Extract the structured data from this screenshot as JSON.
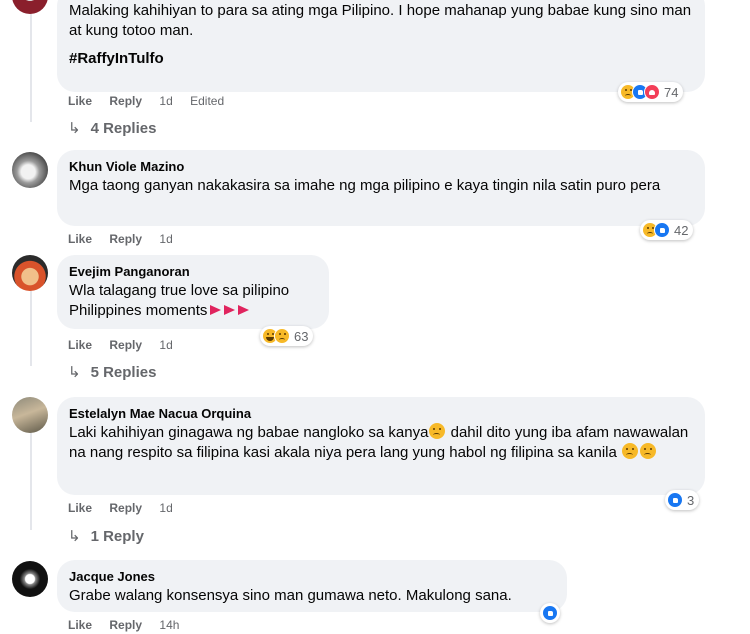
{
  "colors": {
    "bubble": "#f0f2f5",
    "meta": "#65676b",
    "like": "#1877f2",
    "love": "#f33e58",
    "emoji": "#f7b928"
  },
  "comments": [
    {
      "author": "",
      "text": "Malaking kahihiyan to para sa ating mga Pilipino. I hope mahanap yung babae kung sino man at kung totoo man.",
      "hashtag": "#RaffyInTulfo",
      "actions": {
        "like": "Like",
        "reply": "Reply",
        "time": "1d",
        "edited": "Edited"
      },
      "reactions": {
        "icons": [
          "sad",
          "like",
          "love"
        ],
        "count": "74"
      },
      "replies": "4 Replies"
    },
    {
      "author": "Khun Viole Mazino",
      "text": "Mga taong ganyan nakakasira sa imahe ng mga pilipino e kaya tingin nila satin puro pera",
      "actions": {
        "like": "Like",
        "reply": "Reply",
        "time": "1d"
      },
      "reactions": {
        "icons": [
          "sad",
          "like"
        ],
        "count": "42"
      }
    },
    {
      "author": "Evejim Panganoran",
      "text_line1": "Wla talagang true love sa pilipino",
      "text_line2": "Philippines moments",
      "actions": {
        "like": "Like",
        "reply": "Reply",
        "time": "1d"
      },
      "reactions": {
        "icons": [
          "haha",
          "sad"
        ],
        "count": "63"
      },
      "replies": "5 Replies"
    },
    {
      "author": "Estelalyn Mae Nacua Orquina",
      "text_a": "Laki kahihiyan ginagawa ng babae nangloko sa kanya",
      "text_b": " dahil dito yung iba afam nawawalan na nang respito sa filipina kasi akala niya pera lang yung habol ng filipina sa kanila ",
      "actions": {
        "like": "Like",
        "reply": "Reply",
        "time": "1d"
      },
      "reactions": {
        "icons": [
          "like"
        ],
        "count": "3"
      },
      "replies": "1 Reply"
    },
    {
      "author": "Jacque Jones",
      "text": "Grabe walang konsensya sino man gumawa neto. Makulong sana.",
      "actions": {
        "like": "Like",
        "reply": "Reply",
        "time": "14h"
      },
      "reactions": {
        "icons": [
          "like"
        ]
      }
    }
  ]
}
